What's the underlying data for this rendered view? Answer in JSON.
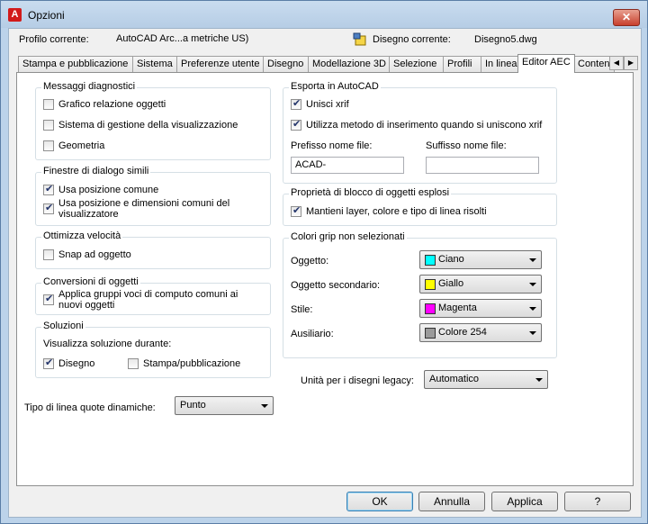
{
  "window": {
    "title": "Opzioni",
    "close_label": "✕"
  },
  "profile": {
    "label": "Profilo corrente:",
    "value": "AutoCAD Arc...a metriche US)",
    "drawing_label": "Disegno corrente:",
    "drawing_value": "Disegno5.dwg"
  },
  "tabs": [
    "Stampa e pubblicazione",
    "Sistema",
    "Preferenze utente",
    "Disegno",
    "Modellazione 3D",
    "Selezione",
    "Profili",
    "In linea",
    "Editor AEC",
    "Conten"
  ],
  "active_tab": "Editor AEC",
  "diagnostics": {
    "title": "Messaggi diagnostici",
    "items": [
      {
        "label": "Grafico relazione oggetti",
        "checked": false
      },
      {
        "label": "Sistema di gestione della visualizzazione",
        "checked": false
      },
      {
        "label": "Geometria",
        "checked": false
      }
    ]
  },
  "similar_dialogs": {
    "title": "Finestre di dialogo simili",
    "items": [
      {
        "label": "Usa posizione comune",
        "checked": true
      },
      {
        "label": "Usa posizione e dimensioni comuni del visualizzatore",
        "checked": true
      }
    ]
  },
  "speed": {
    "title": "Ottimizza velocità",
    "items": [
      {
        "label": "Snap ad oggetto",
        "checked": false
      }
    ]
  },
  "conversions": {
    "title": "Conversioni di oggetti",
    "items": [
      {
        "label": "Applica gruppi voci di computo comuni ai nuovi oggetti",
        "checked": true
      }
    ]
  },
  "solutions": {
    "title": "Soluzioni",
    "subtitle": "Visualizza soluzione durante:",
    "items": [
      {
        "label": "Disegno",
        "checked": true
      },
      {
        "label": "Stampa/pubblicazione",
        "checked": false
      }
    ]
  },
  "dyn_linetype": {
    "label": "Tipo di linea quote dinamiche:",
    "value": "Punto"
  },
  "export": {
    "title": "Esporta in AutoCAD",
    "items": [
      {
        "label": "Unisci xrif",
        "checked": true
      },
      {
        "label": "Utilizza metodo di inserimento quando si uniscono xrif",
        "checked": true
      }
    ],
    "prefix_label": "Prefisso nome file:",
    "prefix_value": "ACAD-",
    "suffix_label": "Suffisso nome file:",
    "suffix_value": ""
  },
  "exploded": {
    "title": "Proprietà di blocco di oggetti esplosi",
    "items": [
      {
        "label": "Mantieni layer, colore e tipo di linea risolti",
        "checked": true
      }
    ]
  },
  "grip_colors": {
    "title": "Colori grip non selezionati",
    "rows": [
      {
        "label": "Oggetto:",
        "value": "Ciano",
        "color": "#00ffff"
      },
      {
        "label": "Oggetto secondario:",
        "value": "Giallo",
        "color": "#ffff00"
      },
      {
        "label": "Stile:",
        "value": "Magenta",
        "color": "#ff00ff"
      },
      {
        "label": "Ausiliario:",
        "value": "Colore 254",
        "color": "#9a9a9a"
      }
    ]
  },
  "legacy_units": {
    "label": "Unità per i disegni legacy:",
    "value": "Automatico"
  },
  "buttons": {
    "ok": "OK",
    "cancel": "Annulla",
    "apply": "Applica",
    "help": "?"
  }
}
